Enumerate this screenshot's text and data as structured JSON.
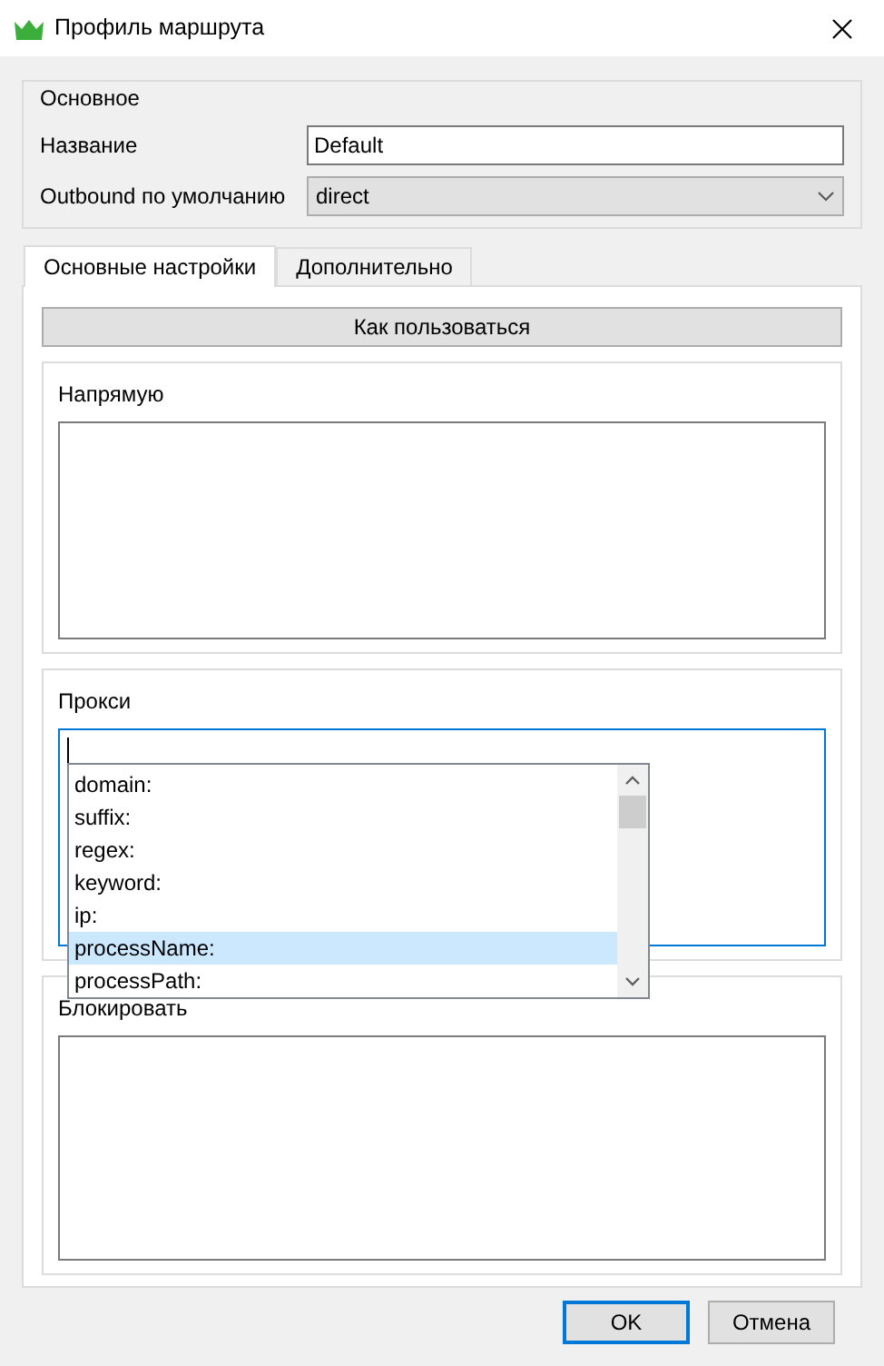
{
  "window": {
    "title": "Профиль маршрута"
  },
  "basic": {
    "title": "Основное",
    "fields": [
      {
        "label": "Название",
        "kind": "text",
        "value": "Default"
      },
      {
        "label": "Outbound по умолчанию",
        "kind": "select",
        "value": "direct"
      }
    ]
  },
  "tabs": [
    {
      "label": "Основные настройки",
      "selected": true
    },
    {
      "label": "Дополнительно",
      "selected": false
    }
  ],
  "help_button": "Как пользоваться",
  "sections": [
    {
      "title": "Напрямую",
      "focused": false
    },
    {
      "title": "Прокси",
      "focused": true,
      "autocomplete": [
        {
          "text": "domain:",
          "selected": false
        },
        {
          "text": "suffix:",
          "selected": false
        },
        {
          "text": "regex:",
          "selected": false
        },
        {
          "text": "keyword:",
          "selected": false
        },
        {
          "text": "ip:",
          "selected": false
        },
        {
          "text": "processName:",
          "selected": true
        },
        {
          "text": "processPath:",
          "selected": false
        }
      ]
    },
    {
      "title": "Блокировать",
      "focused": false
    }
  ],
  "buttons": [
    {
      "label": "OK",
      "default": true
    },
    {
      "label": "Отмена",
      "default": false
    }
  ]
}
